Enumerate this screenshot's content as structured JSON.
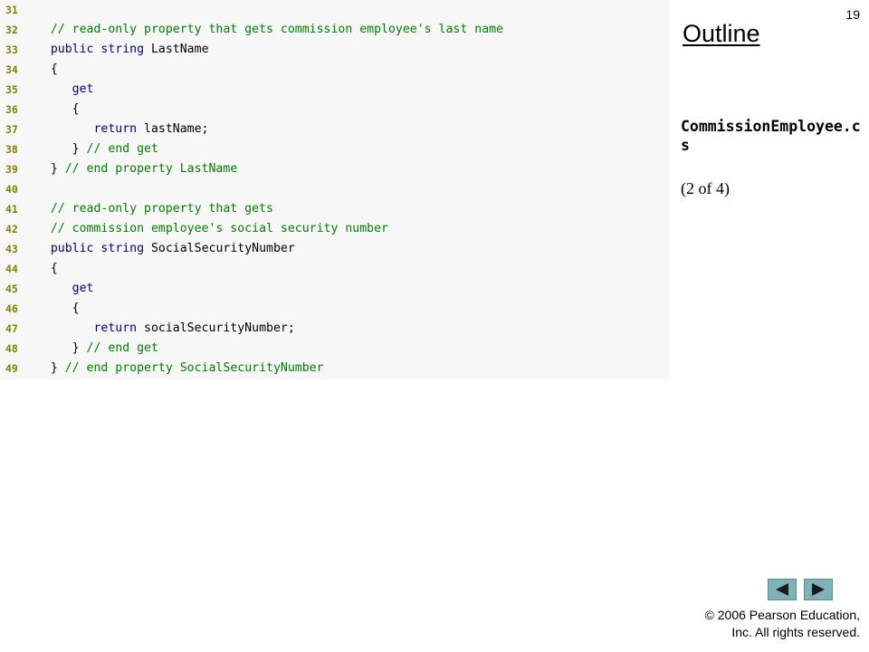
{
  "slide": {
    "page_number": "19",
    "outline_title": "Outline",
    "file_name": "CommissionEmployee.cs",
    "part_label": "(2 of 4)",
    "copyright_line1": "© 2006 Pearson Education,",
    "copyright_line2": "Inc.  All rights reserved."
  },
  "nav": {
    "prev_icon": "triangle-left-icon",
    "next_icon": "triangle-right-icon",
    "button_color": "#7fb2b7"
  },
  "code": {
    "colors": {
      "line_number": "#808000",
      "keyword": "#00008b",
      "comment": "#008000",
      "text": "#000000",
      "background": "#f7f7f7"
    },
    "lines": [
      {
        "n": "31",
        "segments": []
      },
      {
        "n": "32",
        "segments": [
          {
            "t": "   // read-only property that gets commission employee's last name",
            "c": "cm"
          }
        ]
      },
      {
        "n": "33",
        "segments": [
          {
            "t": "   public string",
            "c": "kw"
          },
          {
            "t": " LastName",
            "c": "plain"
          }
        ]
      },
      {
        "n": "34",
        "segments": [
          {
            "t": "   {",
            "c": "plain"
          }
        ]
      },
      {
        "n": "35",
        "segments": [
          {
            "t": "      get",
            "c": "kw"
          }
        ]
      },
      {
        "n": "36",
        "segments": [
          {
            "t": "      {",
            "c": "plain"
          }
        ]
      },
      {
        "n": "37",
        "segments": [
          {
            "t": "         return",
            "c": "kw"
          },
          {
            "t": " lastName;",
            "c": "plain"
          }
        ]
      },
      {
        "n": "38",
        "segments": [
          {
            "t": "      } ",
            "c": "plain"
          },
          {
            "t": "// end get",
            "c": "cm"
          }
        ]
      },
      {
        "n": "39",
        "segments": [
          {
            "t": "   } ",
            "c": "plain"
          },
          {
            "t": "// end property LastName",
            "c": "cm"
          }
        ]
      },
      {
        "n": "40",
        "segments": []
      },
      {
        "n": "41",
        "segments": [
          {
            "t": "   // read-only property that gets",
            "c": "cm"
          }
        ]
      },
      {
        "n": "42",
        "segments": [
          {
            "t": "   // commission employee's social security number",
            "c": "cm"
          }
        ]
      },
      {
        "n": "43",
        "segments": [
          {
            "t": "   public string",
            "c": "kw"
          },
          {
            "t": " SocialSecurityNumber",
            "c": "plain"
          }
        ]
      },
      {
        "n": "44",
        "segments": [
          {
            "t": "   {",
            "c": "plain"
          }
        ]
      },
      {
        "n": "45",
        "segments": [
          {
            "t": "      get",
            "c": "kw"
          }
        ]
      },
      {
        "n": "46",
        "segments": [
          {
            "t": "      {",
            "c": "plain"
          }
        ]
      },
      {
        "n": "47",
        "segments": [
          {
            "t": "         return",
            "c": "kw"
          },
          {
            "t": " socialSecurityNumber;",
            "c": "plain"
          }
        ]
      },
      {
        "n": "48",
        "segments": [
          {
            "t": "      } ",
            "c": "plain"
          },
          {
            "t": "// end get",
            "c": "cm"
          }
        ]
      },
      {
        "n": "49",
        "segments": [
          {
            "t": "   } ",
            "c": "plain"
          },
          {
            "t": "// end property SocialSecurityNumber",
            "c": "cm"
          }
        ]
      }
    ]
  }
}
